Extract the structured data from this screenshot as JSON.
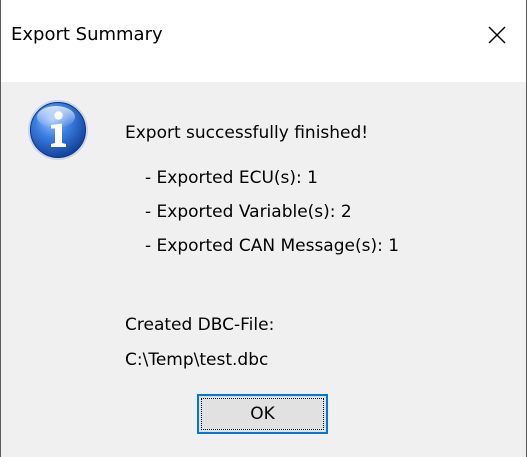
{
  "window": {
    "title": "Export Summary",
    "close_glyph": "✕"
  },
  "icon": {
    "name": "info-icon",
    "accent": "#1f5fc4"
  },
  "message": {
    "headline": "Export successfully finished!",
    "details": [
      "- Exported ECU(s): 1",
      "- Exported Variable(s): 2",
      "- Exported CAN Message(s): 1"
    ],
    "created_label": "Created DBC-File:",
    "file_path": "C:\\Temp\\test.dbc"
  },
  "buttons": {
    "ok_label": "OK"
  }
}
